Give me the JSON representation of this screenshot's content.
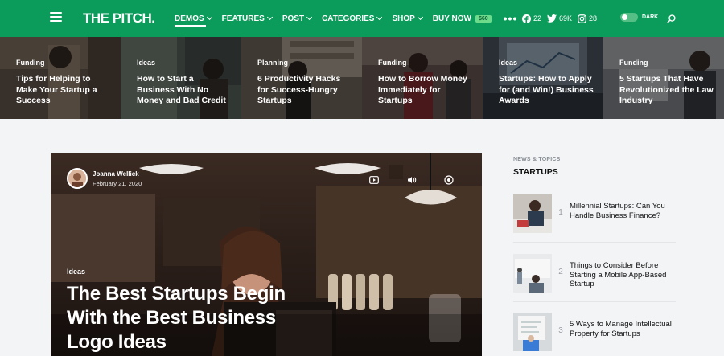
{
  "header": {
    "logo": "THE PITCH.",
    "nav": [
      {
        "label": "DEMOS",
        "active": true,
        "dropdown": true
      },
      {
        "label": "FEATURES",
        "dropdown": true
      },
      {
        "label": "POST",
        "dropdown": true
      },
      {
        "label": "CATEGORIES",
        "dropdown": true
      },
      {
        "label": "SHOP",
        "dropdown": true
      },
      {
        "label": "BUY NOW",
        "badge": "$60"
      }
    ],
    "more_label": "•••",
    "social": {
      "facebook": "22",
      "twitter": "69K",
      "instagram": "28"
    },
    "dark_label": "DARK",
    "accent": "#0b9b5a"
  },
  "strip": [
    {
      "category": "Funding",
      "title": "Tips for Helping to Make Your Startup a Success"
    },
    {
      "category": "Ideas",
      "title": "How to Start a Business With No Money and Bad Credit"
    },
    {
      "category": "Planning",
      "title": "6 Productivity Hacks for Success-Hungry Startups"
    },
    {
      "category": "Funding",
      "title": "How to Borrow Money Immediately for Startups"
    },
    {
      "category": "Ideas",
      "title": "Startups: How to Apply for (and Win!) Business Awards"
    },
    {
      "category": "Funding",
      "title": "5 Startups That Have Revolutionized the Law Industry"
    }
  ],
  "hero": {
    "author": "Joanna Wellick",
    "date": "February 21, 2020",
    "category": "Ideas",
    "title": "The Best Startups Begin With the Best Business Logo Ideas"
  },
  "sidebar": {
    "kicker": "NEWS & TOPICS",
    "title": "STARTUPS",
    "items": [
      {
        "num": "1",
        "title": "Millennial Startups: Can You Handle Business Finance?"
      },
      {
        "num": "2",
        "title": "Things to Consider Before Starting a Mobile App-Based Startup"
      },
      {
        "num": "3",
        "title": "5 Ways to Manage Intellectual Property for Startups"
      }
    ]
  }
}
